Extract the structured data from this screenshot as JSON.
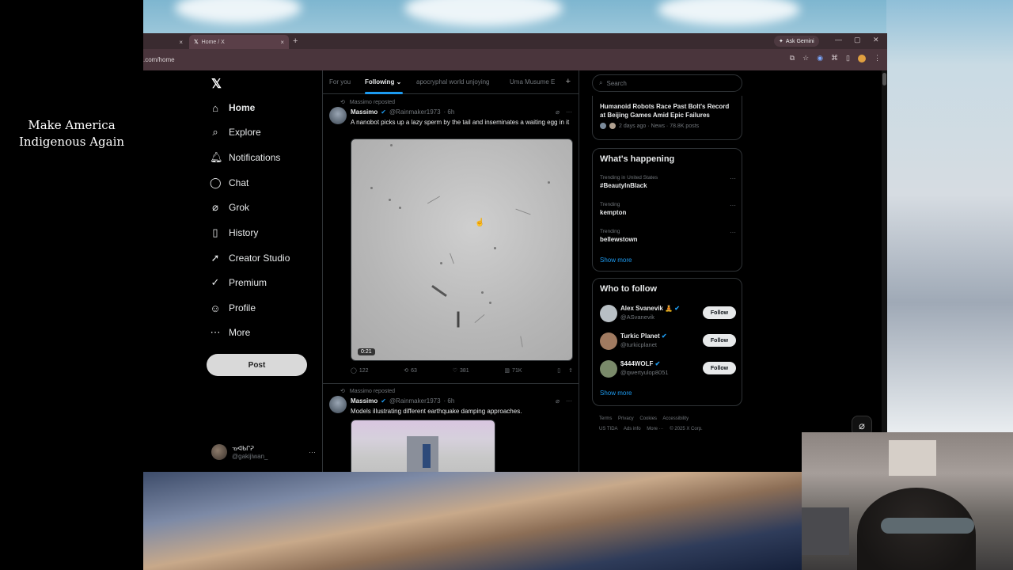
{
  "overlay": {
    "slogan_line1": "Make America",
    "slogan_line2": "Indigenous Again"
  },
  "browser": {
    "tab_inactive_close": "×",
    "tab_active_title": "Home / X",
    "tab_active_close": "×",
    "new_tab": "+",
    "ask_gemini": "Ask Gemini",
    "url": ".com/home"
  },
  "sidebar": {
    "logo": "𝕏",
    "items": [
      {
        "label": "Home",
        "icon": "home-icon",
        "glyph": "⌂"
      },
      {
        "label": "Explore",
        "icon": "search-icon",
        "glyph": "⌕"
      },
      {
        "label": "Notifications",
        "icon": "bell-icon",
        "glyph": "🔔︎"
      },
      {
        "label": "Chat",
        "icon": "chat-icon",
        "glyph": "◯"
      },
      {
        "label": "Grok",
        "icon": "grok-icon",
        "glyph": "⌀"
      },
      {
        "label": "History",
        "icon": "bookmark-icon",
        "glyph": "▯"
      },
      {
        "label": "Creator Studio",
        "icon": "rocket-icon",
        "glyph": "➚"
      },
      {
        "label": "Premium",
        "icon": "premium-icon",
        "glyph": "✓"
      },
      {
        "label": "Profile",
        "icon": "person-icon",
        "glyph": "☺"
      },
      {
        "label": "More",
        "icon": "more-icon",
        "glyph": "⋯"
      }
    ],
    "post_label": "Post",
    "account_name": "ᓀᐊᑲᒋᕈ",
    "account_handle": "@gakijiwan_",
    "account_more": "···"
  },
  "timeline": {
    "tabs": [
      "For you",
      "Following",
      "apocryphal world unjoying",
      "Uma Musume E"
    ],
    "add_tab": "+",
    "tweets": [
      {
        "repost_label": "Massimo reposted",
        "name": "Massimo",
        "handle": "@Rainmaker1973",
        "time": "· 6h",
        "text": "A nanobot picks up a lazy sperm by the tail and inseminates a waiting egg in it",
        "duration": "0:21",
        "replies": "122",
        "reposts": "63",
        "likes": "381",
        "views": "71K"
      },
      {
        "repost_label": "Massimo reposted",
        "name": "Massimo",
        "handle": "@Rainmaker1973",
        "time": "· 6h",
        "text": "Models illustrating different earthquake damping approaches."
      }
    ]
  },
  "right": {
    "search_placeholder": "Search",
    "news": {
      "title": "Humanoid Robots Race Past Bolt's Record at Beijing Games Amid Epic Failures",
      "meta": "2 days ago · News · 78.8K posts"
    },
    "happening_title": "What's happening",
    "trends": [
      {
        "context": "Trending in United States",
        "name": "#BeautyInBlack"
      },
      {
        "context": "Trending",
        "name": "kempton"
      },
      {
        "context": "Trending",
        "name": "bellewstown"
      }
    ],
    "show_more": "Show more",
    "who_title": "Who to follow",
    "who": [
      {
        "name": "Alex Svanevik 🧘",
        "handle": "@ASvanevik",
        "color": "#b8bfc4"
      },
      {
        "name": "Turkic Planet",
        "handle": "@turkicplanet",
        "color": "#a07a60"
      },
      {
        "name": "$444WOLF",
        "handle": "@qwertyulop8051",
        "color": "#7a8a6a"
      }
    ],
    "follow_label": "Follow",
    "footer": [
      "Terms",
      "Privacy",
      "Cookies",
      "Accessibility",
      "US TIDA",
      "Ads info",
      "More ···",
      "© 2025 X Corp."
    ]
  },
  "colors": {
    "accent": "#1d9bf0",
    "border": "#2f3336",
    "muted": "#71767b"
  }
}
